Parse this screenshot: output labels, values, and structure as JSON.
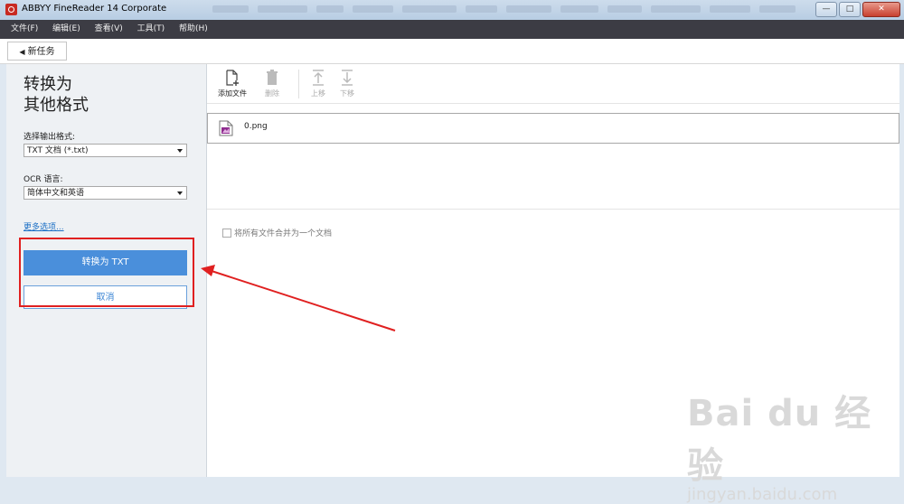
{
  "window": {
    "title": "ABBYY FineReader 14 Corporate",
    "controls": {
      "minimize": "—",
      "maximize": "□",
      "close": "✕"
    }
  },
  "menu": [
    "文件(F)",
    "编辑(E)",
    "查看(V)",
    "工具(T)",
    "帮助(H)"
  ],
  "nav": {
    "new_task": "新任务"
  },
  "left_panel": {
    "title_line1": "转换为",
    "title_line2": "其他格式",
    "format_label": "选择输出格式:",
    "format_value": "TXT 文档 (*.txt)",
    "ocr_label": "OCR 语言:",
    "ocr_value": "简体中文和英语",
    "more_options": "更多选项...",
    "convert_button": "转换为 TXT",
    "cancel_button": "取消"
  },
  "toolbar": {
    "add_file": "添加文件",
    "delete": "删除",
    "move_up": "上移",
    "move_down": "下移"
  },
  "files": [
    {
      "name": "0.png"
    }
  ],
  "merge_option": "将所有文件合并为一个文档",
  "watermark": {
    "main": "Bai du 经验",
    "sub": "jingyan.baidu.com"
  },
  "colors": {
    "accent": "#4a8fdb",
    "menubar": "#3c3c44",
    "highlight": "#e02020"
  }
}
